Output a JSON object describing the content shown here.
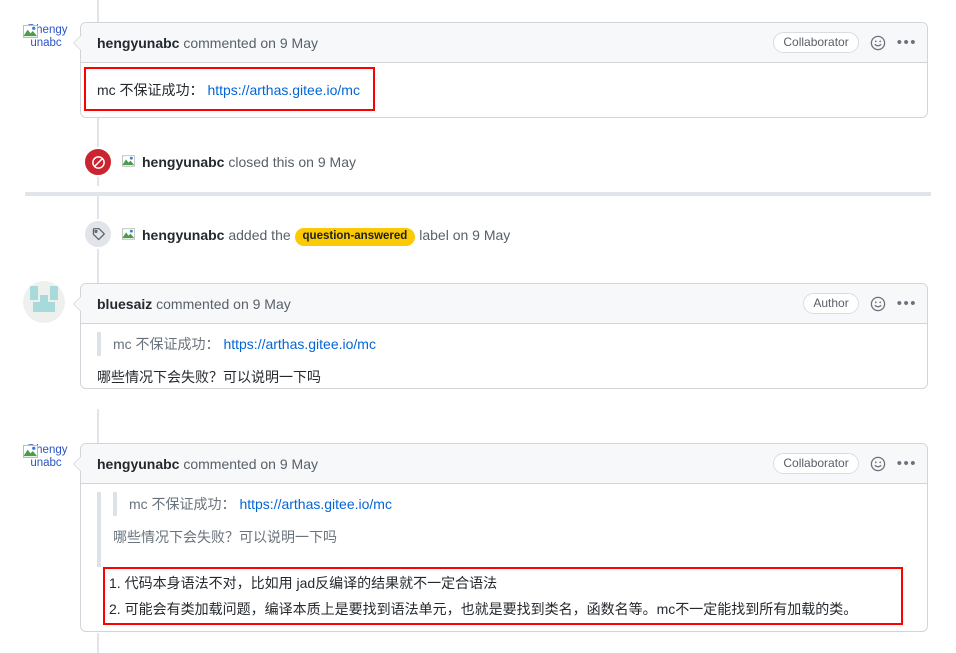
{
  "timeline": [
    {
      "kind": "comment",
      "name": "comment-hengyunabc-1",
      "avatar_alt": "@hengyunabc",
      "author": "hengyunabc",
      "meta": " commented on 9 May",
      "role_badge": "Collaborator",
      "reaction_icon": "smiley-icon",
      "menu_icon": "kebab-menu-icon",
      "body": {
        "line_plain": "mc 不保证成功：",
        "line_link": "https://arthas.gitee.io/mc"
      },
      "highlighted": true
    },
    {
      "kind": "event-closed",
      "name": "event-closed",
      "icon": "closed-circle-slash-icon",
      "avatar_alt": "@hengyunabc",
      "author": "hengyunabc",
      "text": " closed this on 9 May"
    },
    {
      "kind": "event-label",
      "name": "event-label-added",
      "icon": "tag-icon",
      "avatar_alt": "@hengyunabc",
      "author": "hengyunabc",
      "text_before": " added the ",
      "label": "question-answered",
      "text_after": " label on 9 May"
    },
    {
      "kind": "comment",
      "name": "comment-bluesaiz",
      "avatar_type": "identicon",
      "author": "bluesaiz",
      "meta": " commented on 9 May",
      "role_badge": "Author",
      "reaction_icon": "smiley-icon",
      "menu_icon": "kebab-menu-icon",
      "body": {
        "quote_plain": "mc 不保证成功：",
        "quote_link": "https://arthas.gitee.io/mc",
        "reply": "哪些情况下会失败？可以说明一下吗"
      }
    },
    {
      "kind": "comment",
      "name": "comment-hengyunabc-2",
      "avatar_alt": "@hengyunabc",
      "author": "hengyunabc",
      "meta": " commented on 9 May",
      "role_badge": "Collaborator",
      "reaction_icon": "smiley-icon",
      "menu_icon": "kebab-menu-icon",
      "body": {
        "quote_plain": "mc 不保证成功：",
        "quote_link": "https://arthas.gitee.io/mc",
        "quote_reply": "哪些情况下会失败？可以说明一下吗",
        "list_item_1": "1. 代码本身语法不对，比如用 jad反编译的结果就不一定合语法",
        "list_item_2": "2. 可能会有类加载问题，编译本质上是要找到语法单元，也就是要找到类名，函数名等。mc不一定能找到所有加载的类。"
      },
      "highlighted": true
    }
  ],
  "colors": {
    "link": "#0366d6",
    "annotation": "#ff0000",
    "label_yellow": "#fbca04",
    "closed_red": "#cb2431"
  }
}
